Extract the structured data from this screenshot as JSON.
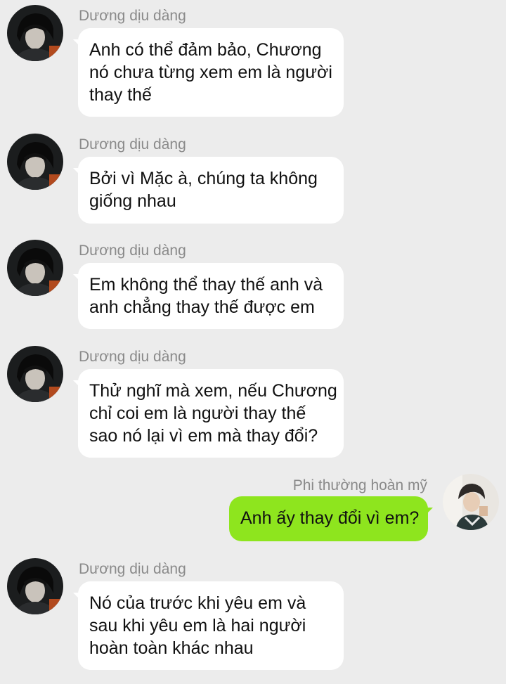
{
  "conversation": {
    "messages": [
      {
        "sender": "Dương dịu dàng",
        "side": "incoming",
        "lines": [
          "Anh có thể đảm bảo, Chương",
          "nó chưa từng xem em là người",
          "thay thế"
        ]
      },
      {
        "sender": "Dương dịu dàng",
        "side": "incoming",
        "lines": [
          "Bởi vì Mặc à, chúng ta không",
          "giống nhau"
        ]
      },
      {
        "sender": "Dương dịu dàng",
        "side": "incoming",
        "lines": [
          "Em không thể thay thế anh và",
          "anh chẳng thay thế được em"
        ]
      },
      {
        "sender": "Dương dịu dàng",
        "side": "incoming",
        "lines": [
          "Thử nghĩ mà xem, nếu Chương",
          "chỉ coi em là người thay thế",
          "sao nó lại vì em mà thay đổi?"
        ]
      },
      {
        "sender": "Phi thường hoàn mỹ",
        "side": "outgoing",
        "lines": [
          "Anh ấy thay đổi vì em?"
        ]
      },
      {
        "sender": "Dương dịu dàng",
        "side": "incoming",
        "lines": [
          "Nó của trước khi yêu em và",
          "sau khi yêu em là hai người",
          "hoàn toàn khác nhau"
        ]
      }
    ]
  },
  "colors": {
    "background": "#ececec",
    "incoming_bubble": "#ffffff",
    "outgoing_bubble": "#8ee51e",
    "sender_name": "#8a8a8a"
  },
  "icons": {
    "incoming_avatar": "user-avatar-dark-photo",
    "outgoing_avatar": "user-avatar-light-photo"
  }
}
